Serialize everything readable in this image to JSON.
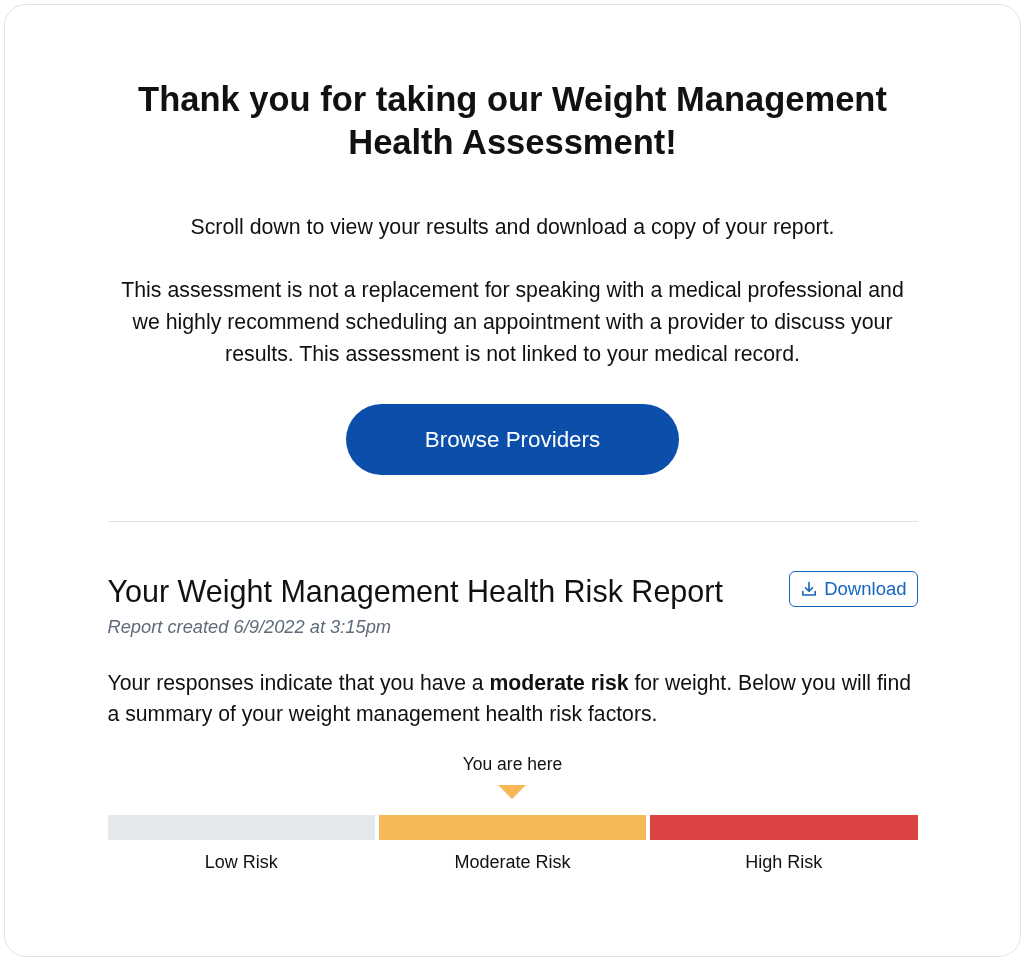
{
  "heading": "Thank you for taking our Weight Management Health Assessment!",
  "intro": "Scroll down to view your results and download a copy of your report.",
  "disclaimer": "This assessment is not a replacement for speaking with a medical professional and we highly recommend scheduling an appointment with a provider to discuss your results. This assessment is not linked to your medical record.",
  "primary_button": "Browse Providers",
  "report": {
    "title": "Your Weight Management Health Risk Report",
    "download_button": "Download",
    "created": "Report created 6/9/2022 at 3:15pm",
    "summary": "Your responses indicate that you have a **moderate risk** for weight. Below you will find a summary of your weight management health risk factors.",
    "risk_meter": {
      "marker_label": "You are here",
      "segments": [
        {
          "label": "Low Risk",
          "color": "#e5e8ec",
          "selected": false
        },
        {
          "label": "Moderate Risk",
          "color": "#f6b955",
          "selected": true
        },
        {
          "label": "High Risk",
          "color": "#dc4444",
          "selected": false
        }
      ]
    }
  }
}
